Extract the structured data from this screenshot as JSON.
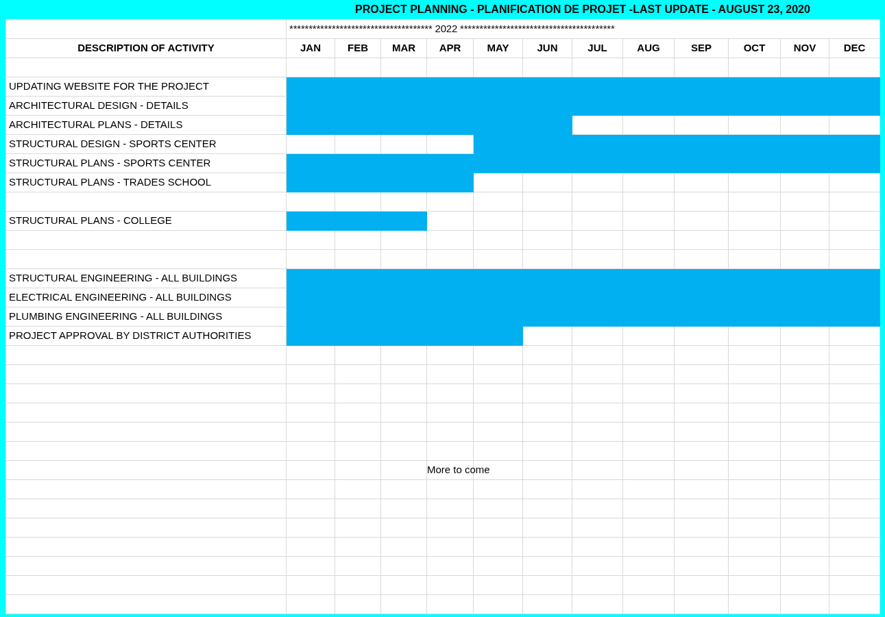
{
  "title": "PROJECT PLANNING - PLANIFICATION DE PROJET -LAST UPDATE - AUGUST 23, 2020",
  "year_banner": "************************************* 2022 ****************************************",
  "header": {
    "description": "DESCRIPTION OF ACTIVITY",
    "months": [
      "JAN",
      "FEB",
      "MAR",
      "APR",
      "MAY",
      "JUN",
      "JUL",
      "AUG",
      "SEP",
      "OCT",
      "NOV",
      "DEC"
    ]
  },
  "rows": [
    {
      "kind": "blank"
    },
    {
      "kind": "activity",
      "text": "UPDATING WEBSITE FOR THE PROJECT",
      "filled": [
        true,
        true,
        true,
        true,
        true,
        true,
        true,
        true,
        true,
        true,
        true,
        true
      ]
    },
    {
      "kind": "activity",
      "text": "ARCHITECTURAL DESIGN - DETAILS",
      "filled": [
        true,
        true,
        true,
        true,
        true,
        true,
        true,
        true,
        true,
        true,
        true,
        true
      ]
    },
    {
      "kind": "activity",
      "text": "ARCHITECTURAL PLANS - DETAILS",
      "filled": [
        true,
        true,
        true,
        true,
        true,
        true,
        false,
        false,
        false,
        false,
        false,
        false
      ]
    },
    {
      "kind": "activity",
      "text": "STRUCTURAL DESIGN - SPORTS CENTER",
      "filled": [
        false,
        false,
        false,
        false,
        true,
        true,
        true,
        true,
        true,
        true,
        true,
        true
      ]
    },
    {
      "kind": "activity",
      "text": "STRUCTURAL PLANS - SPORTS CENTER",
      "filled": [
        true,
        true,
        true,
        true,
        true,
        true,
        true,
        true,
        true,
        true,
        true,
        true
      ]
    },
    {
      "kind": "activity",
      "text": "STRUCTURAL PLANS - TRADES SCHOOL",
      "filled": [
        true,
        true,
        true,
        true,
        false,
        false,
        false,
        false,
        false,
        false,
        false,
        false
      ]
    },
    {
      "kind": "blank"
    },
    {
      "kind": "activity",
      "text": "STRUCTURAL PLANS - COLLEGE",
      "filled": [
        true,
        true,
        true,
        false,
        false,
        false,
        false,
        false,
        false,
        false,
        false,
        false
      ]
    },
    {
      "kind": "blank"
    },
    {
      "kind": "blank"
    },
    {
      "kind": "activity",
      "text": "STRUCTURAL ENGINEERING - ALL BUILDINGS",
      "filled": [
        true,
        true,
        true,
        true,
        true,
        true,
        true,
        true,
        true,
        true,
        true,
        true
      ]
    },
    {
      "kind": "activity",
      "text": "ELECTRICAL ENGINEERING - ALL BUILDINGS",
      "filled": [
        true,
        true,
        true,
        true,
        true,
        true,
        true,
        true,
        true,
        true,
        true,
        true
      ]
    },
    {
      "kind": "activity",
      "text": "PLUMBING ENGINEERING - ALL BUILDINGS",
      "filled": [
        true,
        true,
        true,
        true,
        true,
        true,
        true,
        true,
        true,
        true,
        true,
        true
      ]
    },
    {
      "kind": "activity",
      "text": "PROJECT APPROVAL BY DISTRICT AUTHORITIES",
      "filled": [
        true,
        true,
        true,
        true,
        true,
        false,
        false,
        false,
        false,
        false,
        false,
        false
      ]
    },
    {
      "kind": "blank"
    },
    {
      "kind": "blank"
    },
    {
      "kind": "blank"
    },
    {
      "kind": "blank"
    },
    {
      "kind": "blank"
    },
    {
      "kind": "blank"
    },
    {
      "kind": "note",
      "text": "More to come"
    },
    {
      "kind": "blank"
    },
    {
      "kind": "blank"
    },
    {
      "kind": "blank"
    },
    {
      "kind": "blank"
    },
    {
      "kind": "blank"
    },
    {
      "kind": "blank"
    },
    {
      "kind": "blank"
    }
  ]
}
